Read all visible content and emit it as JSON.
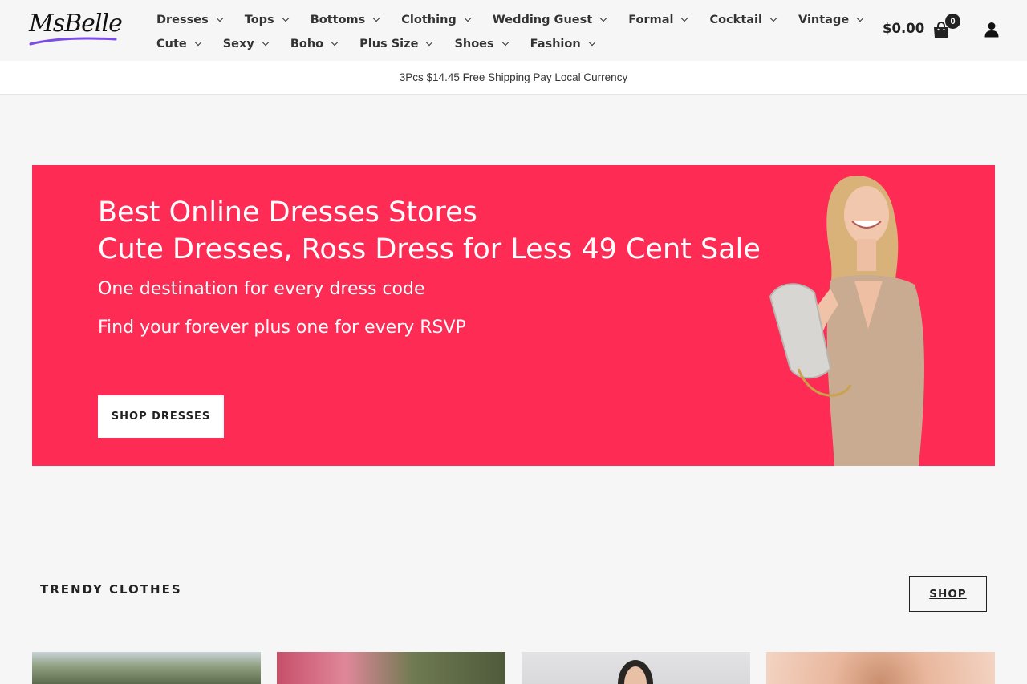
{
  "header": {
    "logo_text": "MsBelle",
    "nav_row1": [
      {
        "label": "Dresses",
        "id": "dresses"
      },
      {
        "label": "Tops",
        "id": "tops"
      },
      {
        "label": "Bottoms",
        "id": "bottoms"
      },
      {
        "label": "Clothing",
        "id": "clothing"
      },
      {
        "label": "Wedding Guest",
        "id": "wedding-guest"
      },
      {
        "label": "Formal",
        "id": "formal"
      },
      {
        "label": "Cocktail",
        "id": "cocktail"
      },
      {
        "label": "Vintage",
        "id": "vintage"
      }
    ],
    "nav_row2": [
      {
        "label": "Cute",
        "id": "cute"
      },
      {
        "label": "Sexy",
        "id": "sexy"
      },
      {
        "label": "Boho",
        "id": "boho"
      },
      {
        "label": "Plus Size",
        "id": "plus-size"
      },
      {
        "label": "Shoes",
        "id": "shoes"
      },
      {
        "label": "Fashion",
        "id": "fashion"
      }
    ],
    "cart_total": "$0.00",
    "cart_count": "0",
    "icons": {
      "cart": "shopping-bag-icon",
      "account": "user-icon",
      "dropdown": "chevron-down-icon"
    }
  },
  "announcement": {
    "text": "3Pcs $14.45 Free Shipping Pay Local Currency"
  },
  "hero": {
    "title_line1": "Best Online Dresses Stores",
    "title_line2": "Cute Dresses, Ross Dress for Less 49 Cent Sale",
    "subtitle1": "One destination for every dress code",
    "subtitle2": "Find your forever plus one for every RSVP",
    "button_label": "SHOP DRESSES",
    "background_color": "#fe2b54"
  },
  "trendy": {
    "title": "TRENDY CLOTHES",
    "shop_label": "SHOP"
  },
  "colors": {
    "brand_accent": "#fe2b54",
    "logo_underline": "#7b4ce6",
    "page_bg": "#f6f6f6"
  }
}
